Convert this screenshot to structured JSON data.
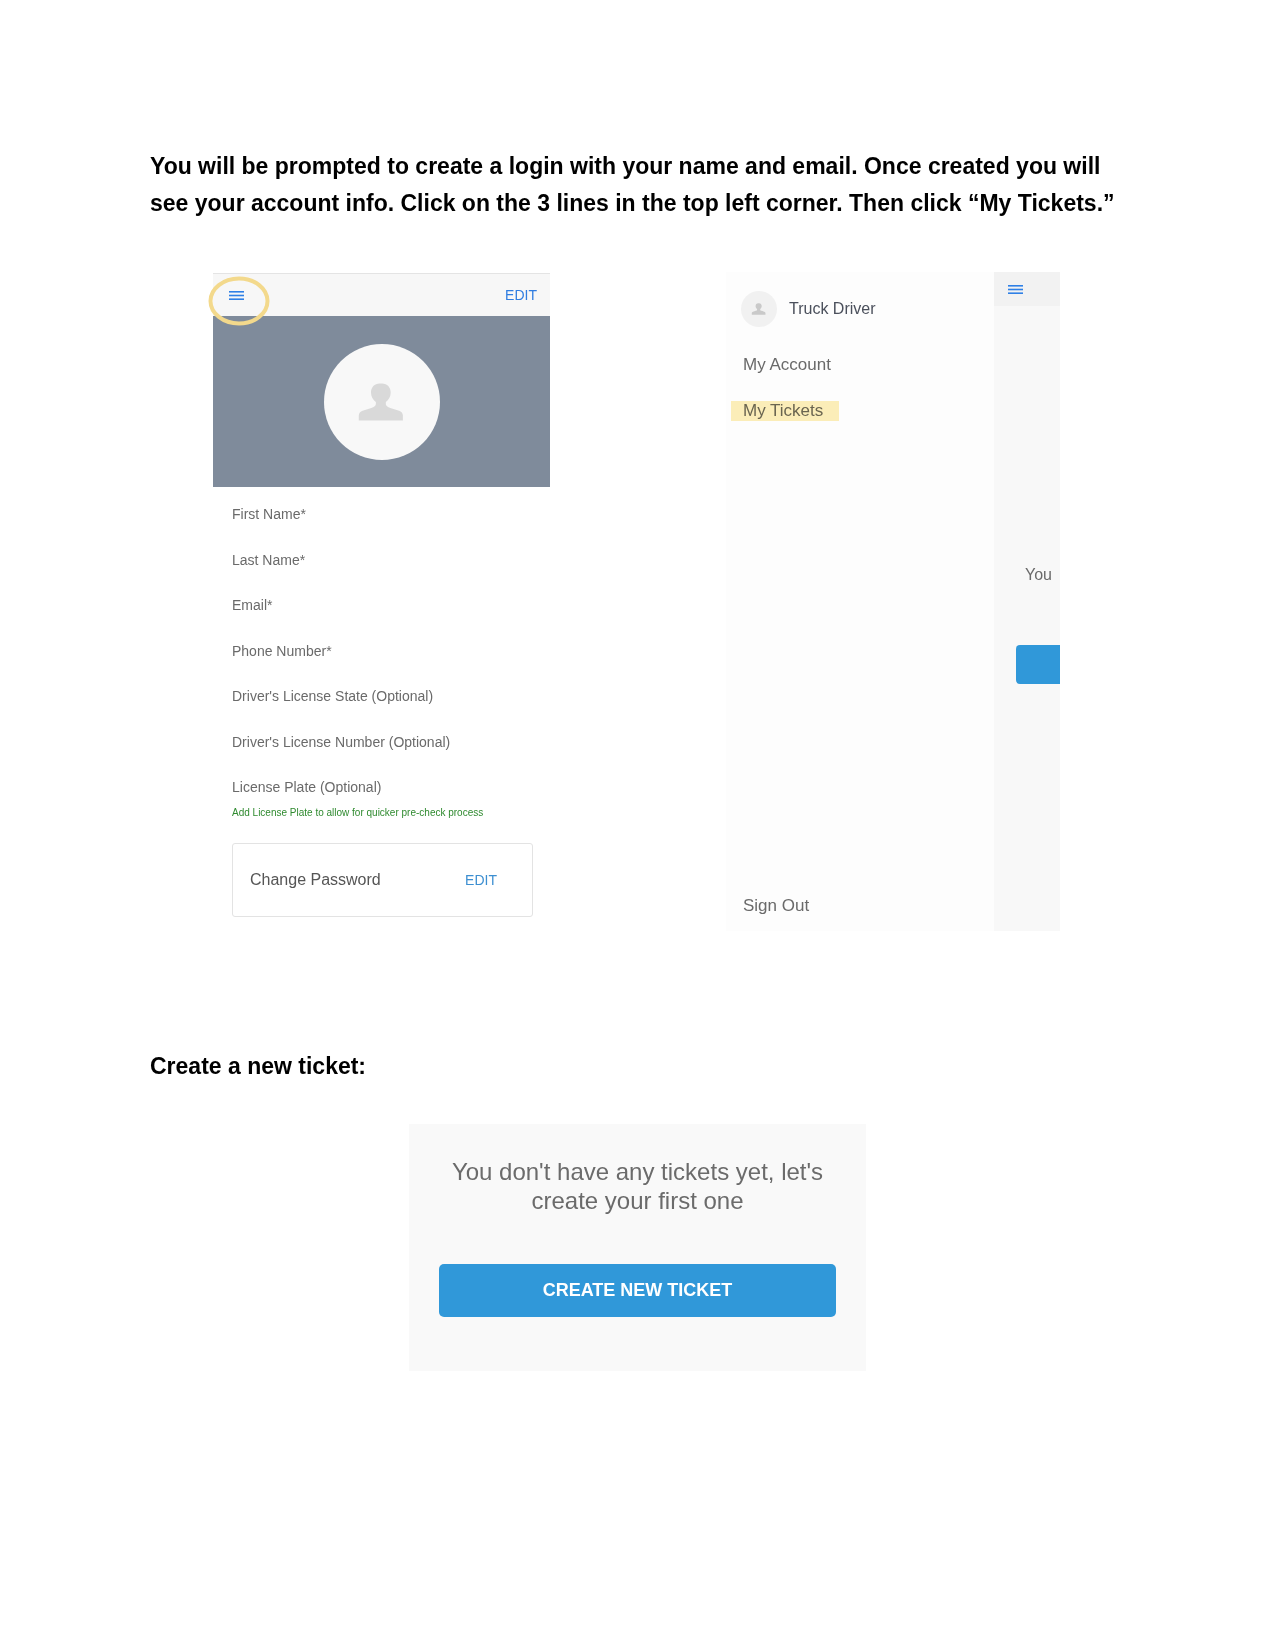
{
  "instructions": "You will be prompted to create a login with your name and email. Once created you will see your account info. Click on the 3 lines in the top left corner. Then click “My Tickets.”",
  "account_screen": {
    "menu_circled": true,
    "edit": "EDIT",
    "fields": [
      "First Name*",
      "Last Name*",
      "Email*",
      "Phone Number*",
      "Driver's License State (Optional)",
      "Driver's License Number (Optional)",
      "License Plate (Optional)"
    ],
    "hint": "Add License Plate to allow for quicker pre-check process",
    "password_card": {
      "label": "Change Password",
      "action": "EDIT"
    }
  },
  "menu_screen": {
    "user_name": "Truck Driver",
    "items": [
      {
        "label": "My Account",
        "highlighted": false
      },
      {
        "label": "My Tickets",
        "highlighted": true
      }
    ],
    "sign_out": "Sign Out",
    "background_screen": {
      "text": "You"
    }
  },
  "section_heading": "Create a new ticket:",
  "tickets_screen": {
    "message": "You don't have any tickets yet, let's create your first one",
    "button": "CREATE NEW TICKET"
  }
}
